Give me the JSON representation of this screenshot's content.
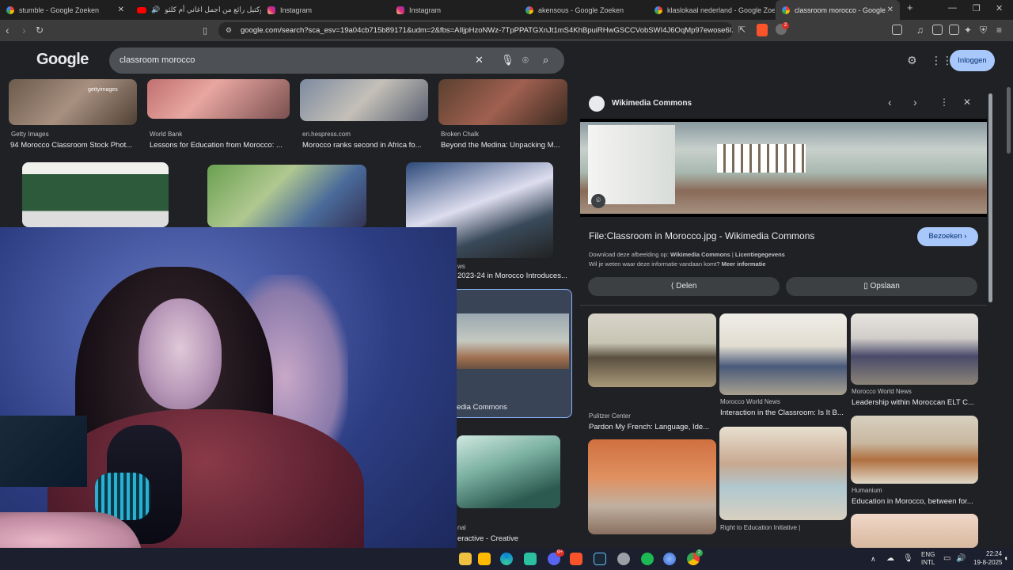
{
  "browser": {
    "tabs": [
      {
        "title": "stumble - Google Zoeken",
        "icon": "google-icon",
        "active": false
      },
      {
        "title": "كوكتيل رائع من اجمل اغاني أم كلثو",
        "icon": "youtube-icon",
        "active": false
      },
      {
        "title": "Instagram",
        "icon": "instagram-icon",
        "active": false
      },
      {
        "title": "Instagram",
        "icon": "instagram-icon",
        "active": false
      },
      {
        "title": "akensous - Google Zoeken",
        "icon": "google-icon",
        "active": false
      },
      {
        "title": "klaslokaal nederland - Google Zoek",
        "icon": "google-icon",
        "active": false
      },
      {
        "title": "classroom morocco - Google Zo",
        "icon": "google-icon",
        "active": true
      }
    ],
    "new_tab": "+",
    "url": "google.com/search?sca_esv=19a04cb715b89171&udm=2&fbs=AIljpHzoNWz-7TpPPATGXnJt1mS4KhBpuiRHwGSCCVobSWI4J6OqMp97ewose6IX3gIF...",
    "extension_badge": "1"
  },
  "google": {
    "logo": "Google",
    "query": "classroom morocco",
    "login_label": "Inloggen"
  },
  "results": {
    "row1": [
      {
        "source": "Getty Images",
        "title": "94 Morocco Classroom Stock Phot...",
        "watermark": "gettyimages"
      },
      {
        "source": "World Bank",
        "title": "Lessons for Education from Morocco: ..."
      },
      {
        "source": "en.hespress.com",
        "title": "Morocco ranks second in Africa fo..."
      },
      {
        "source": "Broken Chalk",
        "title": "Beyond the Medina: Unpacking M..."
      }
    ],
    "row2": [
      {
        "source": "ws",
        "title": "2023-24 in Morocco Introduces..."
      }
    ],
    "selected": {
      "source": "edia Commons"
    },
    "row4": [
      {
        "source": "nal",
        "title": "eractive - Creative"
      }
    ]
  },
  "panel": {
    "site": "Wikimedia Commons",
    "title": "File:Classroom in Morocco.jpg - Wikimedia Commons",
    "visit_label": "Bezoeken",
    "download_line_prefix": "Download deze afbeelding op: ",
    "download_link": "Wikimedia Commons",
    "license_sep": " | ",
    "license_link": "Licentiegegevens",
    "info_line": "Wil je weten waar deze informatie vandaan komt? ",
    "info_link": "Meer informatie",
    "share_label": "Delen",
    "save_label": "Opslaan",
    "related": [
      {
        "source": "Pulitzer Center",
        "title": "Pardon My French: Language, Ide..."
      },
      {
        "source": "Morocco World News",
        "title": "Interaction in the Classroom: Is It B..."
      },
      {
        "source": "Morocco World News",
        "title": "Leadership within Moroccan ELT C..."
      },
      {
        "source": "Humanium",
        "title": "Education in Morocco, between for..."
      },
      {
        "source": "Right to Education Initiative |",
        "title": ""
      }
    ]
  },
  "taskbar": {
    "lang": "ENG",
    "lang_sub": "INTL",
    "time": "22:24",
    "date": "19-8-2025",
    "discord_badge": "9+",
    "app_badge": "2"
  }
}
